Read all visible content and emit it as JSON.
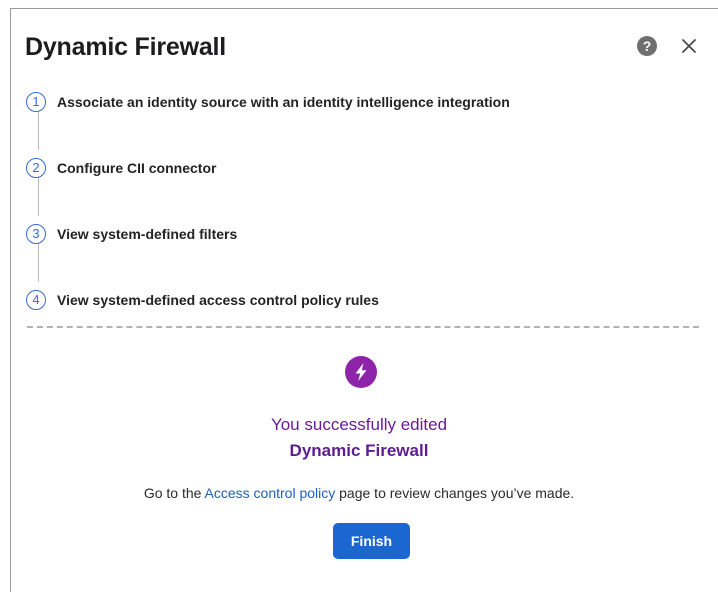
{
  "dialog": {
    "title": "Dynamic Firewall",
    "help_icon": "help-icon",
    "help_glyph": "?",
    "close_icon": "close-icon"
  },
  "steps": [
    {
      "number": "1",
      "label": "Associate an identity source with an identity intelligence integration"
    },
    {
      "number": "2",
      "label": "Configure CII connector"
    },
    {
      "number": "3",
      "label": "View system-defined filters"
    },
    {
      "number": "4",
      "label": "View system-defined access control policy rules"
    }
  ],
  "result": {
    "icon": "lightning-bolt-icon",
    "line1": "You successfully edited",
    "line2": "Dynamic Firewall",
    "info_prefix": "Go to the ",
    "info_link": "Access control policy",
    "info_suffix": " page to review changes you’ve made."
  },
  "actions": {
    "finish_label": "Finish"
  },
  "colors": {
    "step_accent": "#3a6bd1",
    "success_purple": "#6a1b9a",
    "icon_purple": "#8e24aa",
    "link_blue": "#1f5fbf",
    "primary_button": "#1a67d2"
  }
}
